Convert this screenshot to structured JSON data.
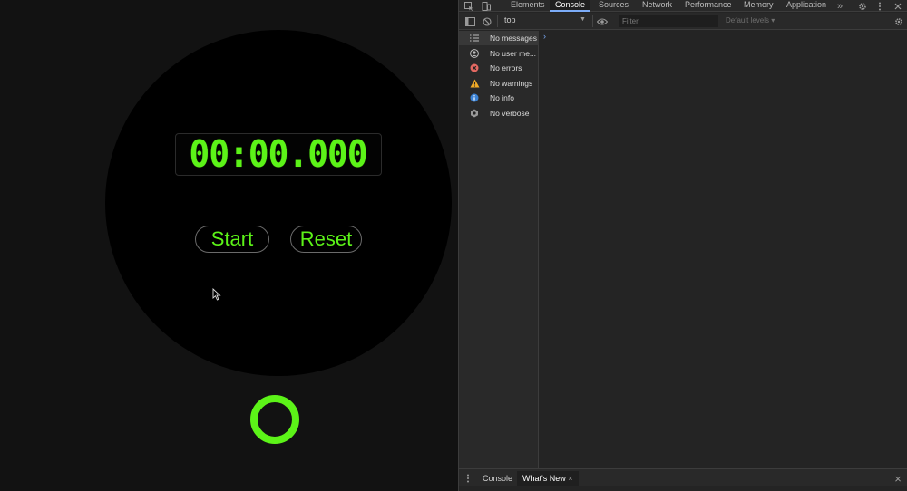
{
  "stopwatch": {
    "time": "00:00.000",
    "start_label": "Start",
    "reset_label": "Reset",
    "accent": "#5cf318"
  },
  "devtools": {
    "tabs": [
      "Elements",
      "Console",
      "Sources",
      "Network",
      "Performance",
      "Memory",
      "Application"
    ],
    "active_tab": "Console",
    "more_tabs": "»",
    "context": "top",
    "filter_placeholder": "Filter",
    "levels_label": "Default levels ▾",
    "sidebar": [
      {
        "label": "No messages",
        "icon": "list-icon"
      },
      {
        "label": "No user me...",
        "icon": "user-icon"
      },
      {
        "label": "No errors",
        "icon": "error-icon"
      },
      {
        "label": "No warnings",
        "icon": "warning-icon"
      },
      {
        "label": "No info",
        "icon": "info-icon"
      },
      {
        "label": "No verbose",
        "icon": "verbose-icon"
      }
    ],
    "prompt": "›",
    "drawer_tabs": [
      "Console",
      "What's New"
    ],
    "drawer_close": "×"
  }
}
